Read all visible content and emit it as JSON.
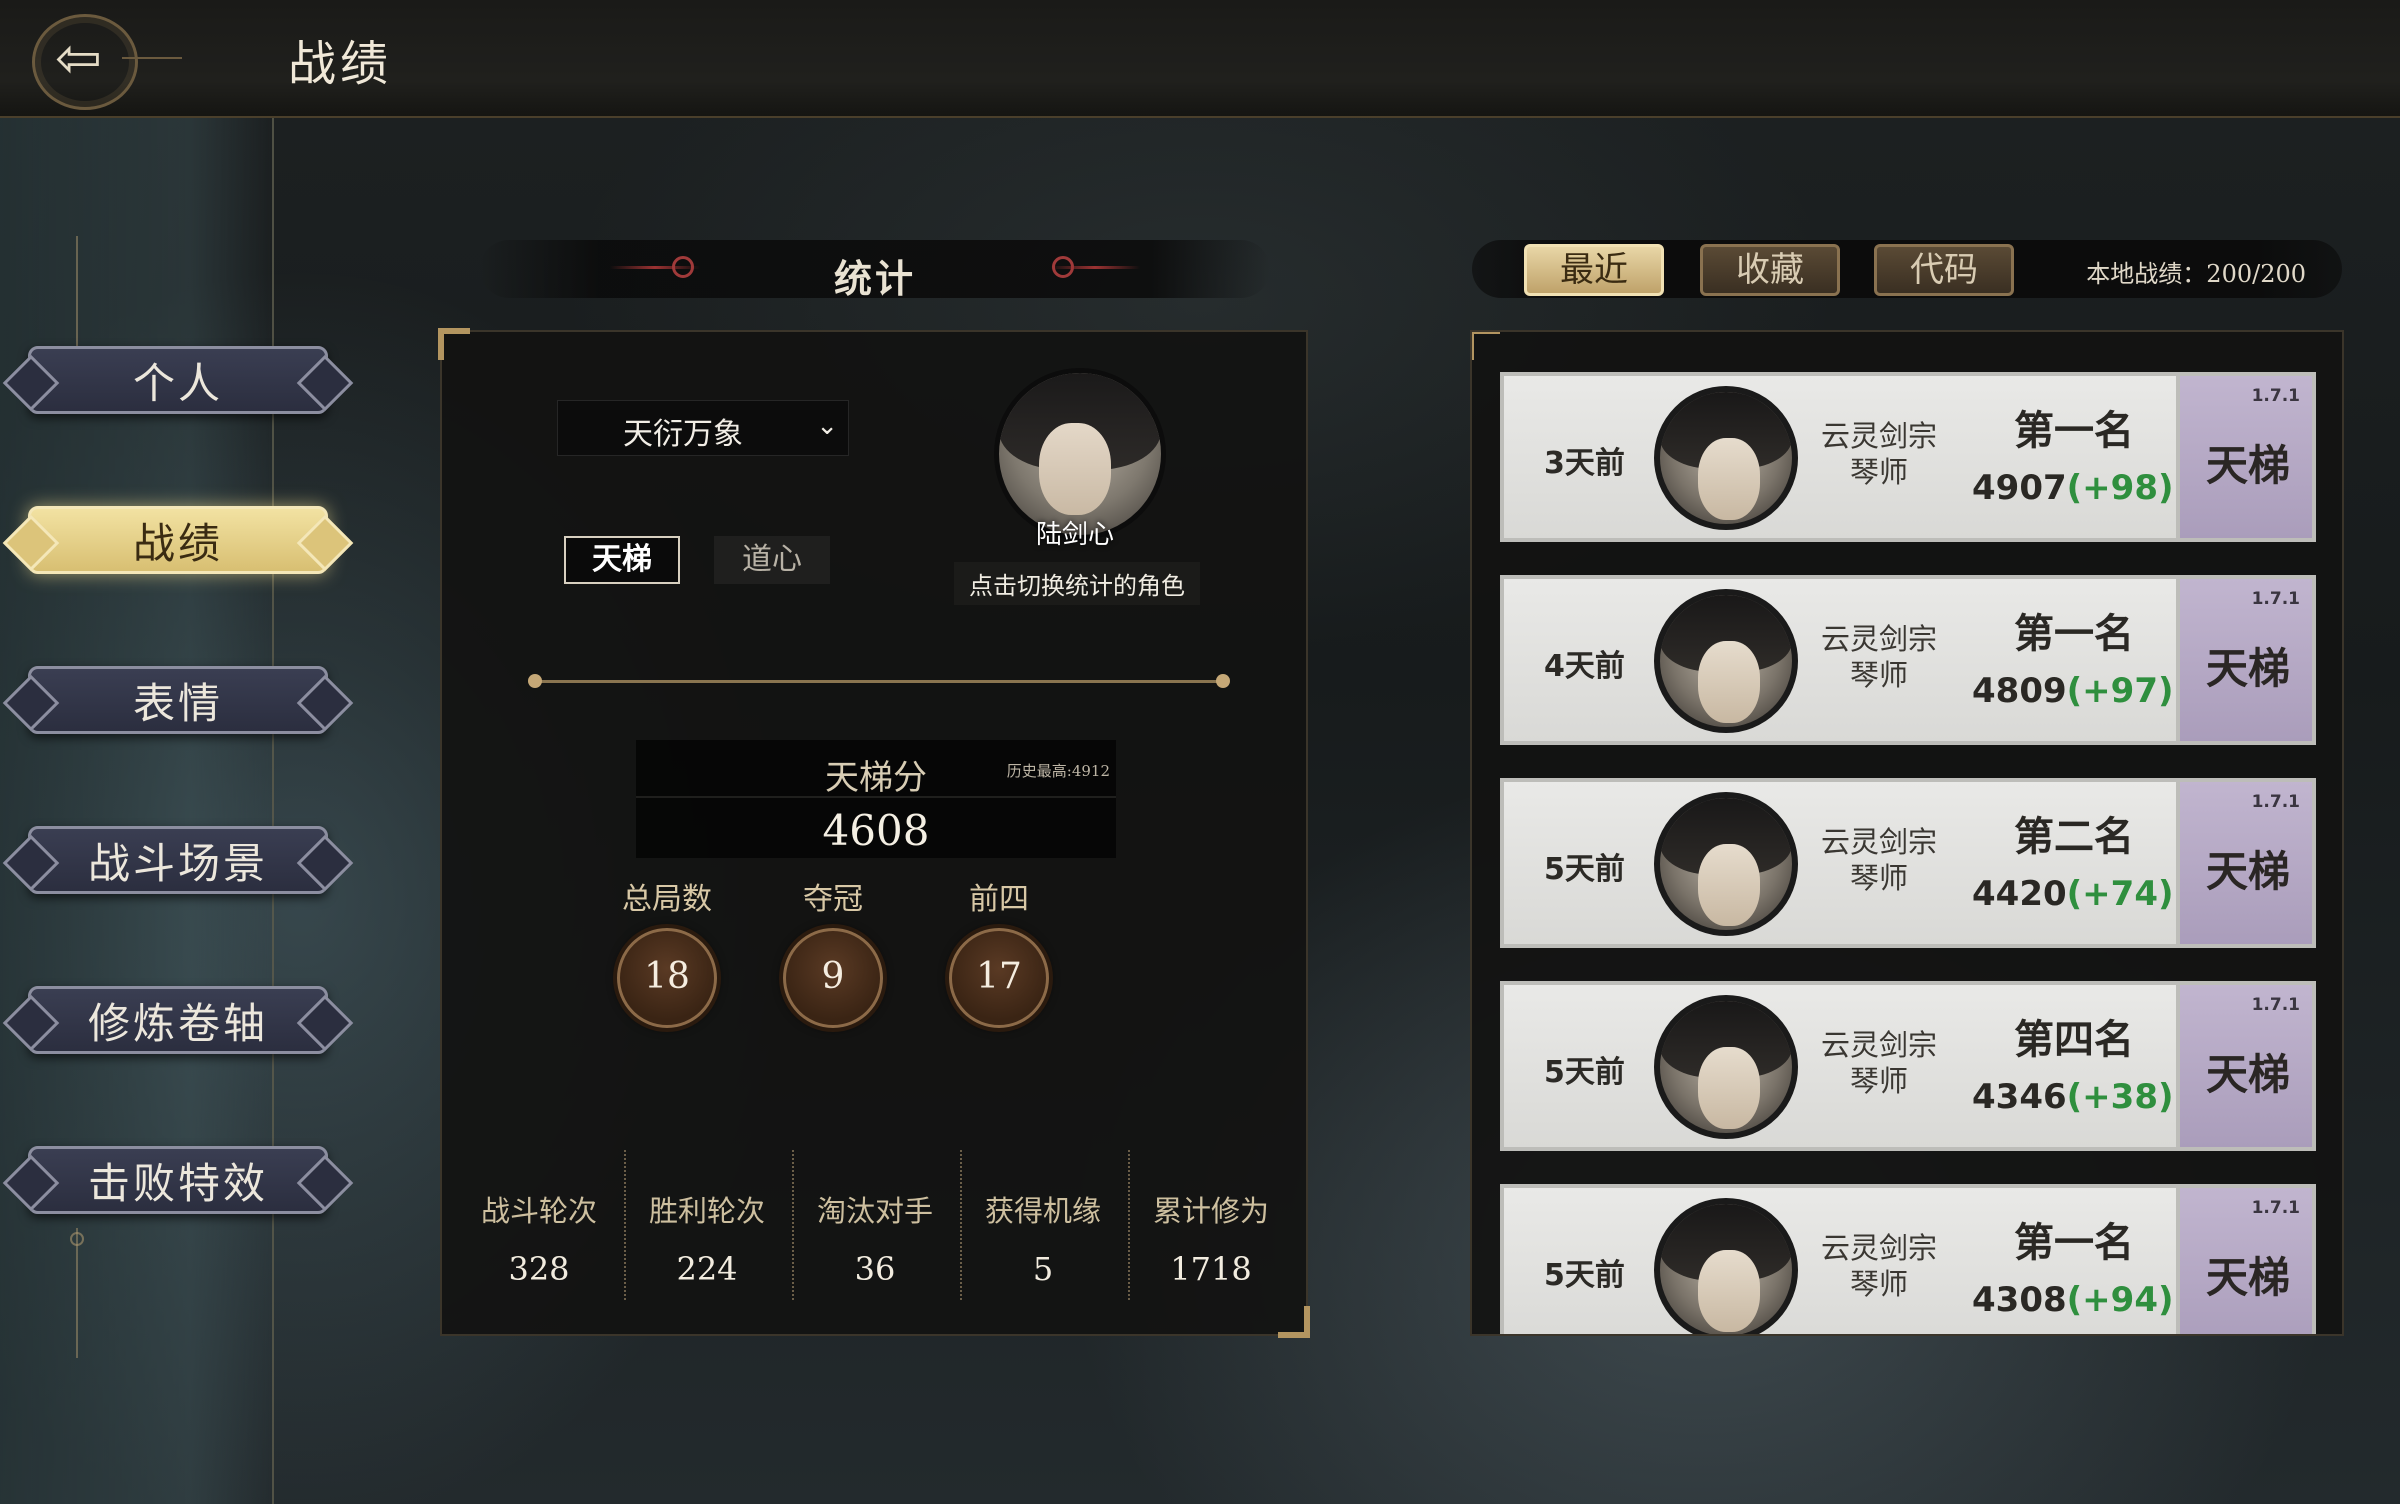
{
  "header": {
    "title": "战绩",
    "back_icon": "back-arrow-icon"
  },
  "sidebar": {
    "items": [
      {
        "label": "个人",
        "active": false
      },
      {
        "label": "战绩",
        "active": true
      },
      {
        "label": "表情",
        "active": false
      },
      {
        "label": "战斗场景",
        "active": false
      },
      {
        "label": "修炼卷轴",
        "active": false
      },
      {
        "label": "击败特效",
        "active": false
      }
    ]
  },
  "stats": {
    "title": "统计",
    "mode_select": "天衍万象",
    "tabs": {
      "ladder": "天梯",
      "dao": "道心"
    },
    "character": {
      "name": "陆剑心",
      "hint": "点击切换统计的角色"
    },
    "ladder_score": {
      "label": "天梯分",
      "best": "历史最高:4912",
      "value": "4608"
    },
    "circles": [
      {
        "label": "总局数",
        "value": "18"
      },
      {
        "label": "夺冠",
        "value": "9"
      },
      {
        "label": "前四",
        "value": "17"
      }
    ],
    "bottom": [
      {
        "label": "战斗轮次",
        "value": "328"
      },
      {
        "label": "胜利轮次",
        "value": "224"
      },
      {
        "label": "淘汰对手",
        "value": "36"
      },
      {
        "label": "获得机缘",
        "value": "5"
      },
      {
        "label": "累计修为",
        "value": "1718"
      }
    ]
  },
  "records": {
    "tabs": [
      {
        "label": "最近",
        "active": true
      },
      {
        "label": "收藏",
        "active": false
      },
      {
        "label": "代码",
        "active": false
      }
    ],
    "local_count": "本地战绩：200/200",
    "items": [
      {
        "time": "3天前",
        "sect_line1": "云灵剑宗",
        "sect_line2": "琴师",
        "rank": "第一名",
        "score": "4907",
        "delta": "(+98)",
        "version": "1.7.1",
        "mode": "天梯"
      },
      {
        "time": "4天前",
        "sect_line1": "云灵剑宗",
        "sect_line2": "琴师",
        "rank": "第一名",
        "score": "4809",
        "delta": "(+97)",
        "version": "1.7.1",
        "mode": "天梯"
      },
      {
        "time": "5天前",
        "sect_line1": "云灵剑宗",
        "sect_line2": "琴师",
        "rank": "第二名",
        "score": "4420",
        "delta": "(+74)",
        "version": "1.7.1",
        "mode": "天梯"
      },
      {
        "time": "5天前",
        "sect_line1": "云灵剑宗",
        "sect_line2": "琴师",
        "rank": "第四名",
        "score": "4346",
        "delta": "(+38)",
        "version": "1.7.1",
        "mode": "天梯"
      },
      {
        "time": "5天前",
        "sect_line1": "云灵剑宗",
        "sect_line2": "琴师",
        "rank": "第一名",
        "score": "4308",
        "delta": "(+94)",
        "version": "1.7.1",
        "mode": "天梯"
      }
    ]
  },
  "colors": {
    "accent_gold": "#d8bf72",
    "positive_delta": "#2f8f3e",
    "mode_badge": "#b3a6c4",
    "nav_button": "#2b2e3f"
  }
}
